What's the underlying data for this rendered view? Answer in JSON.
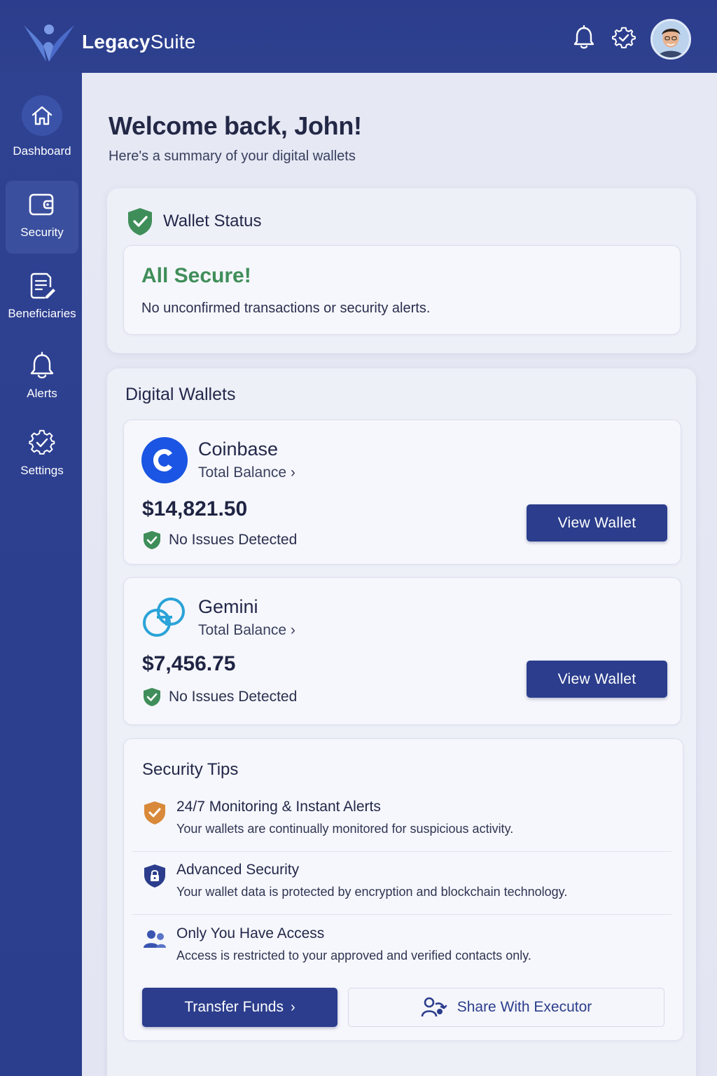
{
  "header": {
    "brand_bold": "Legacy",
    "brand_light": "Suite",
    "icons": [
      "bell-icon",
      "gear-icon",
      "avatar"
    ]
  },
  "sidebar": {
    "items": [
      {
        "label": "Dashboard",
        "icon": "home-icon"
      },
      {
        "label": "Security",
        "icon": "wallet-icon",
        "active": true
      },
      {
        "label": "Beneficiaries",
        "icon": "document-edit-icon"
      },
      {
        "label": "Alerts",
        "icon": "bell-icon"
      },
      {
        "label": "Settings",
        "icon": "gear-icon"
      }
    ]
  },
  "main": {
    "welcome": "Welcome back, John!",
    "subtitle": "Here's a summary of your digital wallets",
    "status": {
      "title": "Wallet Status",
      "headline": "All Secure!",
      "description": "No unconfirmed transactions or security alerts."
    },
    "wallets_title": "Digital Wallets",
    "wallets": [
      {
        "name": "Coinbase",
        "balance_label": "Total Balance ›",
        "amount": "$14,821.50",
        "status": "No Issues Detected",
        "button": "View Wallet"
      },
      {
        "name": "Gemini",
        "balance_label": "Total Balance ›",
        "amount": "$7,456.75",
        "status": "No Issues Detected",
        "button": "View Wallet"
      }
    ],
    "tips": {
      "title": "Security Tips",
      "items": [
        {
          "title": "24/7 Monitoring & Instant Alerts",
          "desc": "Your wallets are continually monitored for suspicious activity.",
          "icon": "shield-check-icon"
        },
        {
          "title": "Advanced Security",
          "desc": "Your wallet data is protected by encryption and blockchain technology.",
          "icon": "shield-lock-icon"
        },
        {
          "title": "Only You Have Access",
          "desc": "Access is restricted to your approved and verified contacts only.",
          "icon": "users-icon"
        }
      ]
    },
    "actions": {
      "transfer": "Transfer Funds",
      "share": "Share With Executor"
    }
  },
  "colors": {
    "brand_navy": "#2b3d8c",
    "success_green": "#3f8e5a",
    "tip_orange": "#d9893a",
    "coinbase_blue": "#1a55e3",
    "gemini_cyan": "#2aa3d8"
  }
}
